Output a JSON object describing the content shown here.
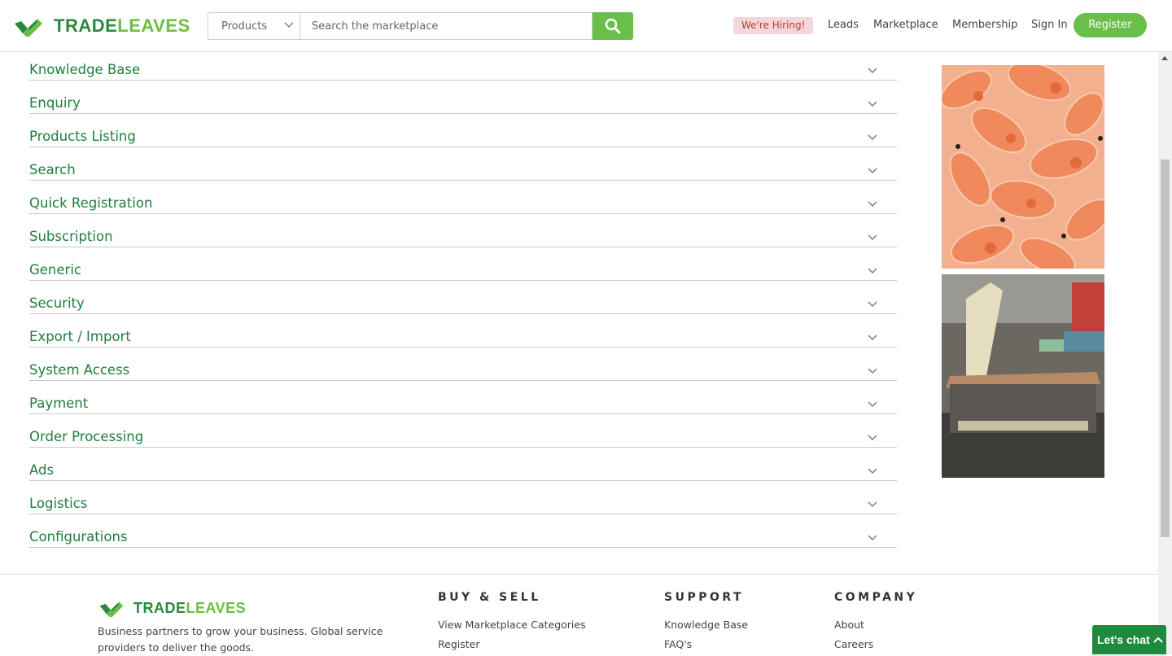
{
  "brand": {
    "name_part1": "TRADE",
    "name_part2": "LEAVES",
    "primary_color": "#2a8a3c",
    "accent_color": "#6abf4b"
  },
  "header": {
    "search_category": "Products",
    "search_placeholder": "Search the marketplace",
    "hiring_label": "We're Hiring!",
    "nav": {
      "leads": "Leads",
      "marketplace": "Marketplace",
      "membership": "Membership",
      "sign_in": "Sign In",
      "register": "Register"
    }
  },
  "faq_sections": [
    "Knowledge Base",
    "Enquiry",
    "Products Listing",
    "Search",
    "Quick Registration",
    "Subscription",
    "Generic",
    "Security",
    "Export / Import",
    "System Access",
    "Payment",
    "Order Processing",
    "Ads",
    "Logistics",
    "Configurations"
  ],
  "footer": {
    "tagline": "Business partners to grow your business. Global service providers to deliver the goods.",
    "buy_sell": {
      "heading": "BUY & SELL",
      "links": [
        "View Marketplace Categories",
        "Register"
      ]
    },
    "support": {
      "heading": "SUPPORT",
      "links": [
        "Knowledge Base",
        "FAQ's"
      ]
    },
    "company": {
      "heading": "COMPANY",
      "links": [
        "About",
        "Careers"
      ]
    }
  },
  "chat": {
    "label": "Let's chat"
  }
}
